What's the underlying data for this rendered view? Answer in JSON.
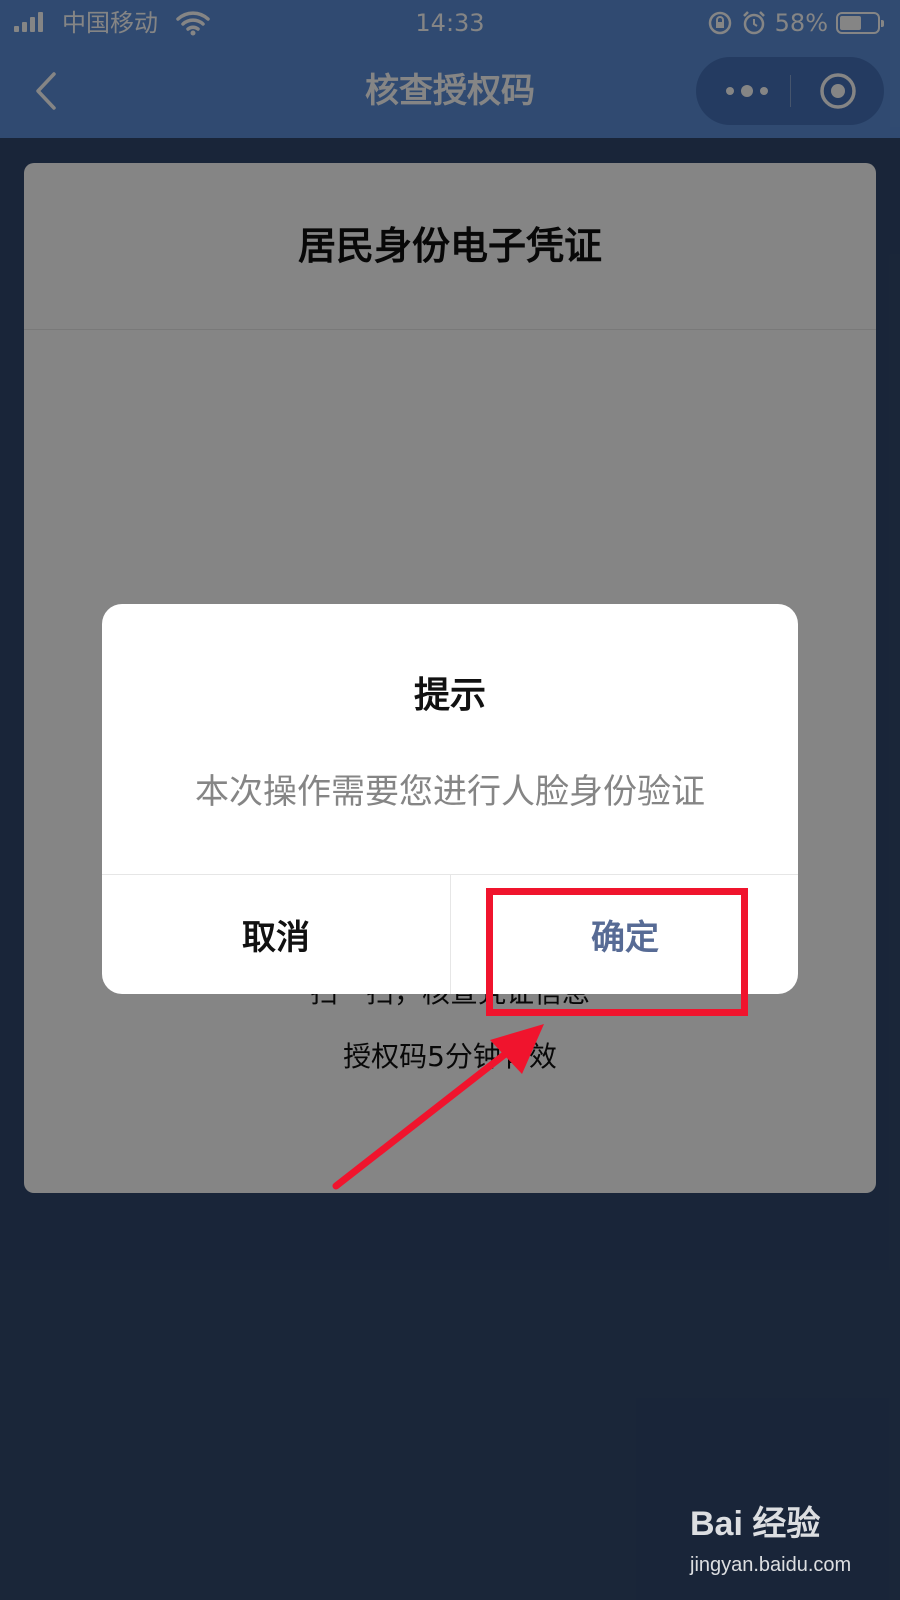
{
  "status_bar": {
    "carrier": "中国移动",
    "time": "14:33",
    "battery": "58%",
    "battery_level": 0.58
  },
  "navbar": {
    "title": "核查授权码"
  },
  "card": {
    "title": "居民身份电子凭证",
    "scan_text": "扫一扫，核查凭证信息",
    "validity_text": "授权码5分钟有效"
  },
  "dialog": {
    "title": "提示",
    "message": "本次操作需要您进行人脸身份验证",
    "cancel_label": "取消",
    "confirm_label": "确定"
  },
  "colors": {
    "nav_blue": "#5d8fd8",
    "page_bg": "#31486d",
    "confirm_text": "#576b95",
    "annotation_red": "#f0142d"
  },
  "watermark": {
    "logo": "Bai  经验",
    "url": "jingyan.baidu.com"
  }
}
